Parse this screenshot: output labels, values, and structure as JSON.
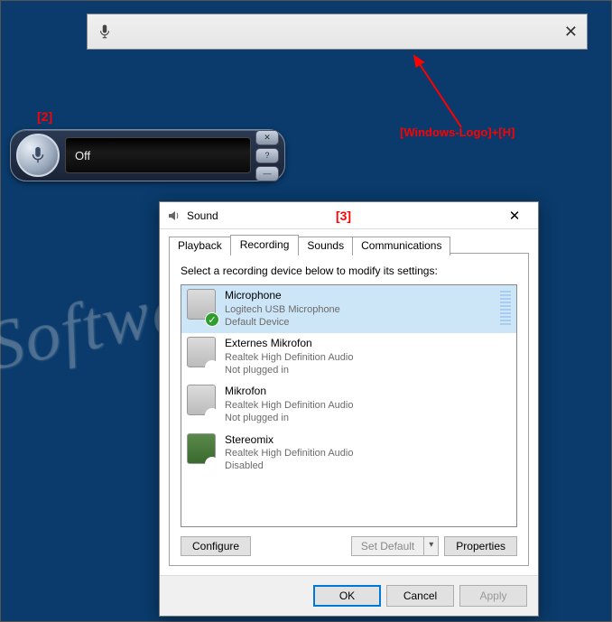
{
  "watermark": "SoftwareOK.com",
  "annotations": {
    "label2": "[2]",
    "label3": "[3]",
    "hotkey": "[Windows-Logo]+[H]"
  },
  "speech_bar": {
    "mic_icon": "microphone-icon",
    "close_glyph": "✕"
  },
  "speech_widget": {
    "status": "Off"
  },
  "sound_dialog": {
    "title": "Sound",
    "close_glyph": "✕",
    "tabs": [
      {
        "label": "Playback",
        "active": false
      },
      {
        "label": "Recording",
        "active": true
      },
      {
        "label": "Sounds",
        "active": false
      },
      {
        "label": "Communications",
        "active": false
      }
    ],
    "instruction": "Select a recording device below to modify its settings:",
    "devices": [
      {
        "name": "Microphone",
        "sub1": "Logitech USB Microphone",
        "sub2": "Default Device",
        "badge": "ok",
        "selected": true,
        "has_level": true
      },
      {
        "name": "Externes Mikrofon",
        "sub1": "Realtek High Definition Audio",
        "sub2": "Not plugged in",
        "badge": "down",
        "selected": false,
        "has_level": false
      },
      {
        "name": "Mikrofon",
        "sub1": "Realtek High Definition Audio",
        "sub2": "Not plugged in",
        "badge": "down",
        "selected": false,
        "has_level": false
      },
      {
        "name": "Stereomix",
        "sub1": "Realtek High Definition Audio",
        "sub2": "Disabled",
        "badge": "disabled",
        "selected": false,
        "has_level": false,
        "chip": true
      }
    ],
    "buttons": {
      "configure": "Configure",
      "set_default": "Set Default",
      "properties": "Properties",
      "ok": "OK",
      "cancel": "Cancel",
      "apply": "Apply"
    }
  }
}
